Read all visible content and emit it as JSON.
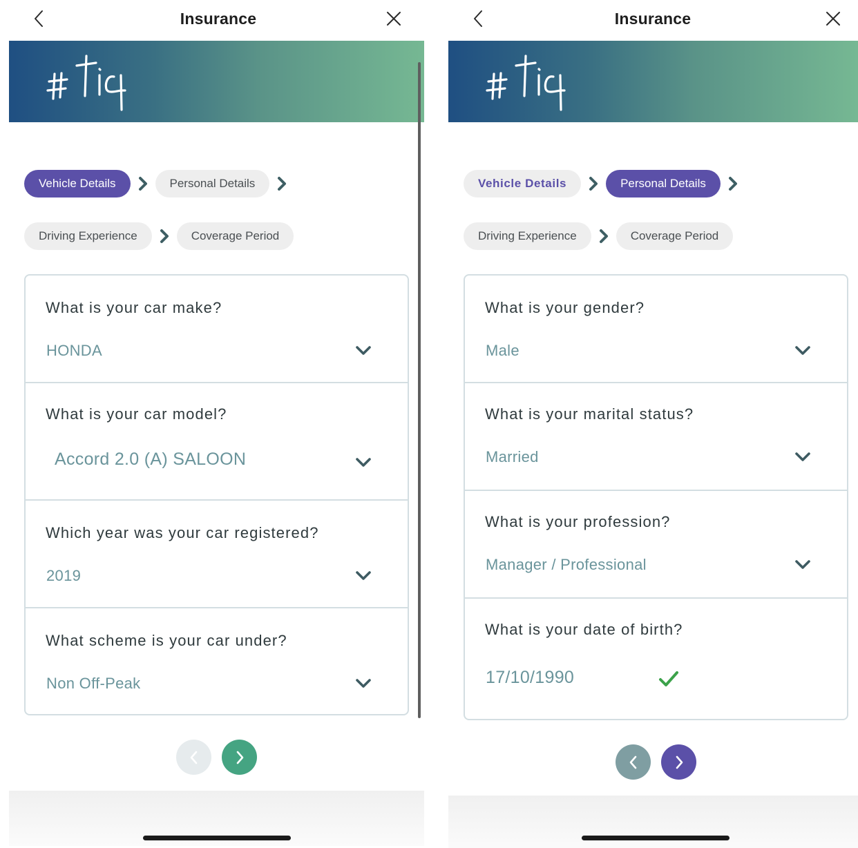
{
  "colors": {
    "accent_purple": "#5b50a8",
    "accent_green": "#45a482",
    "disabled_gray": "#e6ebed",
    "secondary_gray": "#7f9ea2",
    "value_text": "#6a949b",
    "check_green": "#3ca24a"
  },
  "screens": [
    {
      "title": "Insurance",
      "logo_text": "#tiq",
      "steps": [
        {
          "label": "Vehicle Details",
          "state": "active"
        },
        {
          "label": "Personal Details",
          "state": "pending"
        },
        {
          "label": "Driving Experience",
          "state": "pending"
        },
        {
          "label": "Coverage Period",
          "state": "pending"
        }
      ],
      "fields": [
        {
          "question": "What is your car make?",
          "value": "HONDA",
          "control": "dropdown"
        },
        {
          "question": "What is your car model?",
          "value": "Accord 2.0 (A)  SALOON",
          "control": "dropdown"
        },
        {
          "question": "Which year was your car registered?",
          "value": "2019",
          "control": "dropdown"
        },
        {
          "question": "What scheme is your car under?",
          "value": "Non Off-Peak",
          "control": "dropdown"
        }
      ],
      "pager": {
        "prev_enabled": false,
        "next_enabled": true
      }
    },
    {
      "title": "Insurance",
      "logo_text": "#tiq",
      "steps": [
        {
          "label": "Vehicle Details",
          "state": "done"
        },
        {
          "label": "Personal Details",
          "state": "active"
        },
        {
          "label": "Driving Experience",
          "state": "pending"
        },
        {
          "label": "Coverage Period",
          "state": "pending"
        }
      ],
      "fields": [
        {
          "question": "What is your gender?",
          "value": "Male",
          "control": "dropdown"
        },
        {
          "question": "What is your marital status?",
          "value": "Married",
          "control": "dropdown"
        },
        {
          "question": "What is your profession?",
          "value": "Manager / Professional",
          "control": "dropdown"
        },
        {
          "question": "What is your date of birth?",
          "value": "17/10/1990",
          "control": "date-valid"
        }
      ],
      "pager": {
        "prev_enabled": true,
        "next_enabled": true
      }
    }
  ]
}
